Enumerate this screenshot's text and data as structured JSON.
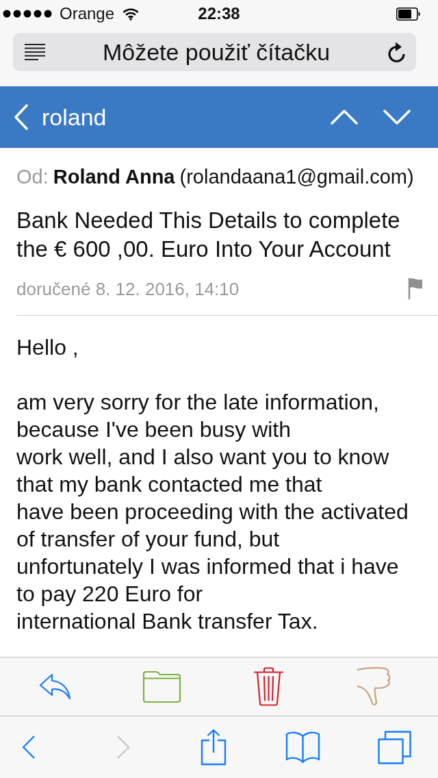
{
  "status_bar": {
    "carrier": "Orange",
    "time": "22:38"
  },
  "address_bar": {
    "text": "Môžete použiť čítačku"
  },
  "nav_bar": {
    "back_label": "roland"
  },
  "message": {
    "from_label": "Od:",
    "sender_name": "Roland Anna",
    "sender_email": "(rolandaana1@gmail.com)",
    "subject": "Bank Needed This Details to complete the € 600 ,00. Euro Into Your Account",
    "received": "doručené 8. 12. 2016, 14:10",
    "greeting": "Hello ,",
    "body": "am very sorry for the late information,\nbecause I've been busy with\nwork well, and I also want you to know\nthat my bank contacted me that\nhave been proceeding with the activated\nof transfer of your fund, but\nunfortunately I was informed that i have\nto pay 220 Euro for\ninternational Bank transfer Tax."
  },
  "browser_toolbar": {
    "back": {
      "disabled": false
    },
    "forward": {
      "disabled": true
    }
  }
}
